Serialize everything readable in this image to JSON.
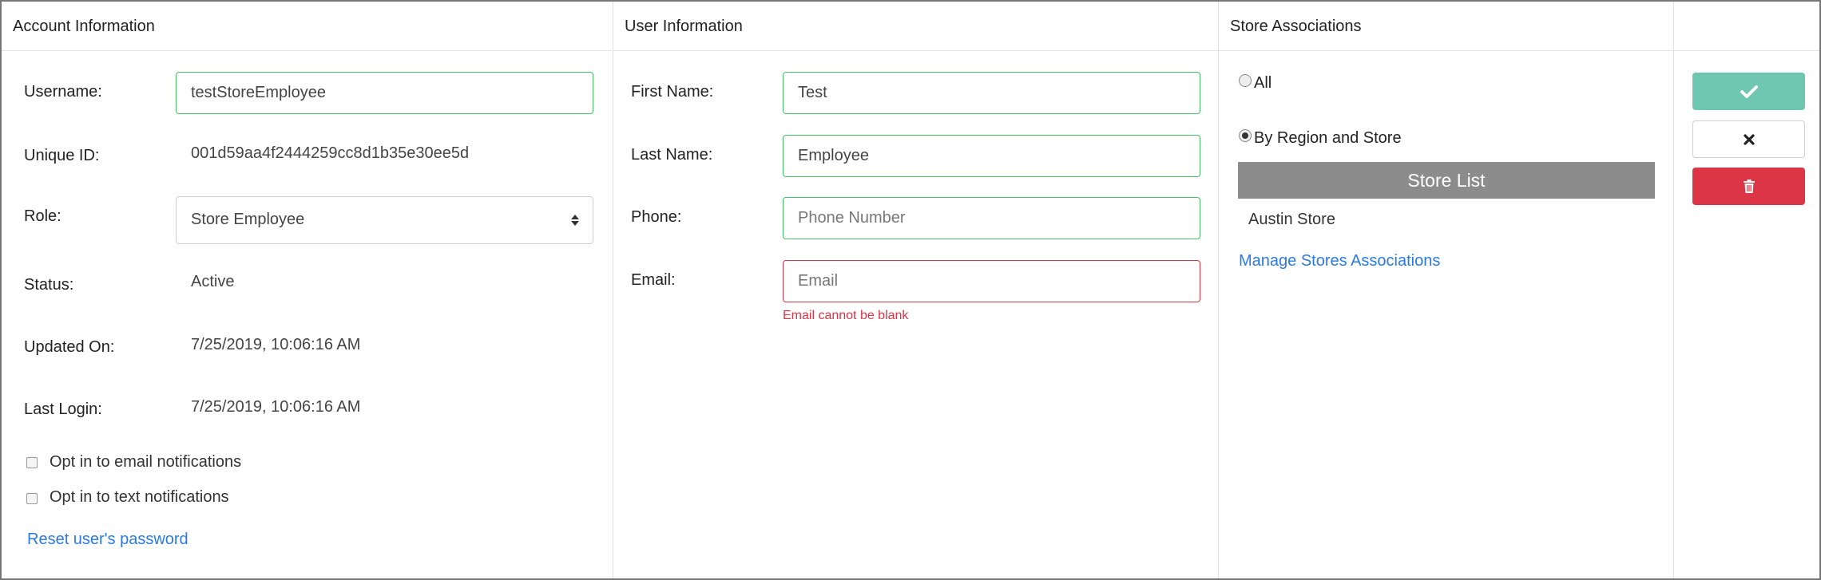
{
  "columns": {
    "account": "Account Information",
    "user": "User Information",
    "store": "Store Associations"
  },
  "account": {
    "username_label": "Username:",
    "username_value": "testStoreEmployee",
    "unique_id_label": "Unique ID:",
    "unique_id_value": "001d59aa4f2444259cc8d1b35e30ee5d",
    "role_label": "Role:",
    "role_value": "Store Employee",
    "status_label": "Status:",
    "status_value": "Active",
    "updated_label": "Updated On:",
    "updated_value": "7/25/2019, 10:06:16 AM",
    "last_login_label": "Last Login:",
    "last_login_value": "7/25/2019, 10:06:16 AM",
    "opt_email": "Opt in to email notifications",
    "opt_text": "Opt in to text notifications",
    "reset_link": "Reset user's password"
  },
  "user": {
    "first_name_label": "First Name:",
    "first_name_value": "Test",
    "last_name_label": "Last Name:",
    "last_name_value": "Employee",
    "phone_label": "Phone:",
    "phone_placeholder": "Phone Number",
    "email_label": "Email:",
    "email_placeholder": "Email",
    "email_error": "Email cannot be blank"
  },
  "store": {
    "option_all": "All",
    "option_region": "By Region and Store",
    "selected_option": "By Region and Store",
    "list_header": "Store List",
    "stores": [
      "Austin Store"
    ],
    "manage_link": "Manage Stores Associations"
  },
  "actions": {
    "save_icon": "check-icon",
    "cancel_icon": "close-icon",
    "delete_icon": "trash-icon"
  },
  "colors": {
    "valid_border": "#46c065",
    "error": "#dc3545",
    "save_button": "#6fc6b1",
    "link": "#2a7ae2",
    "store_list_header": "#8c8c8c"
  }
}
